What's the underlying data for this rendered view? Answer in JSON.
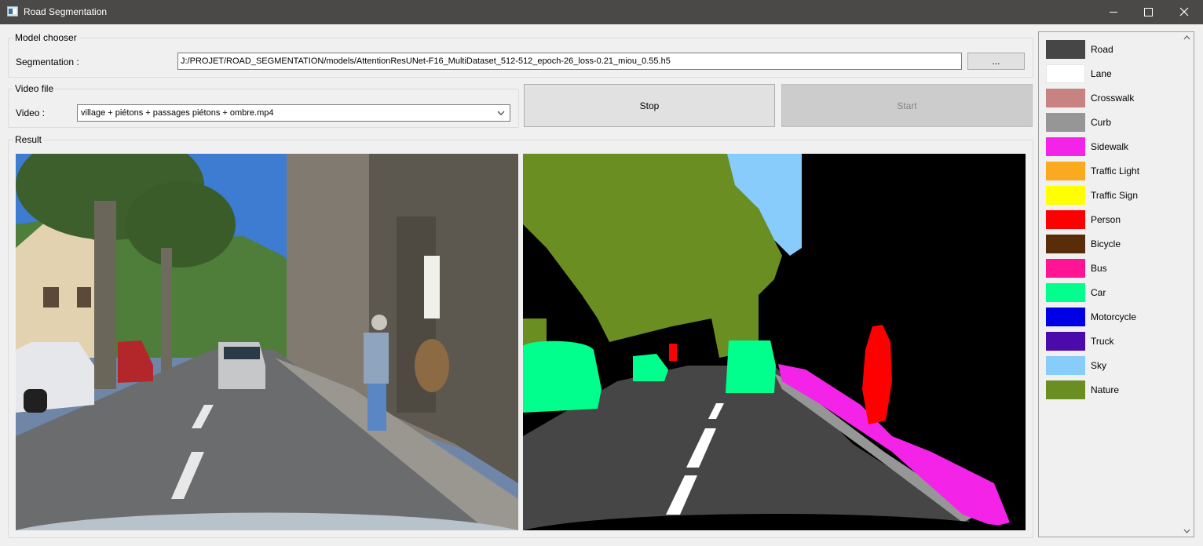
{
  "window": {
    "title": "Road Segmentation",
    "controls": [
      "minimize-icon",
      "maximize-icon",
      "close-icon"
    ]
  },
  "model_chooser": {
    "group_title": "Model chooser",
    "segmentation_label": "Segmentation :",
    "segmentation_path": "J:/PROJET/ROAD_SEGMENTATION/models/AttentionResUNet-F16_MultiDataset_512-512_epoch-26_loss-0.21_miou_0.55.h5",
    "browse_label": "..."
  },
  "video_file": {
    "group_title": "Video file",
    "video_label": "Video :",
    "selected_video": "village + piétons + passages piétons + ombre.mp4"
  },
  "actions": {
    "stop_label": "Stop",
    "start_label": "Start",
    "start_enabled": false
  },
  "result": {
    "group_title": "Result"
  },
  "legend": [
    {
      "label": "Road",
      "color": "#464646"
    },
    {
      "label": "Lane",
      "color": "#ffffff"
    },
    {
      "label": "Crosswalk",
      "color": "#c88282"
    },
    {
      "label": "Curb",
      "color": "#969696"
    },
    {
      "label": "Sidewalk",
      "color": "#f423e8"
    },
    {
      "label": "Traffic Light",
      "color": "#faaa1e"
    },
    {
      "label": "Traffic Sign",
      "color": "#ffff00"
    },
    {
      "label": "Person",
      "color": "#ff0000"
    },
    {
      "label": "Bicycle",
      "color": "#5a2d0a"
    },
    {
      "label": "Bus",
      "color": "#ff1493"
    },
    {
      "label": "Car",
      "color": "#00ff8c"
    },
    {
      "label": "Motorcycle",
      "color": "#0000e6"
    },
    {
      "label": "Truck",
      "color": "#4b0aaa"
    },
    {
      "label": "Sky",
      "color": "#87ccfa"
    },
    {
      "label": "Nature",
      "color": "#6b8e23"
    }
  ]
}
